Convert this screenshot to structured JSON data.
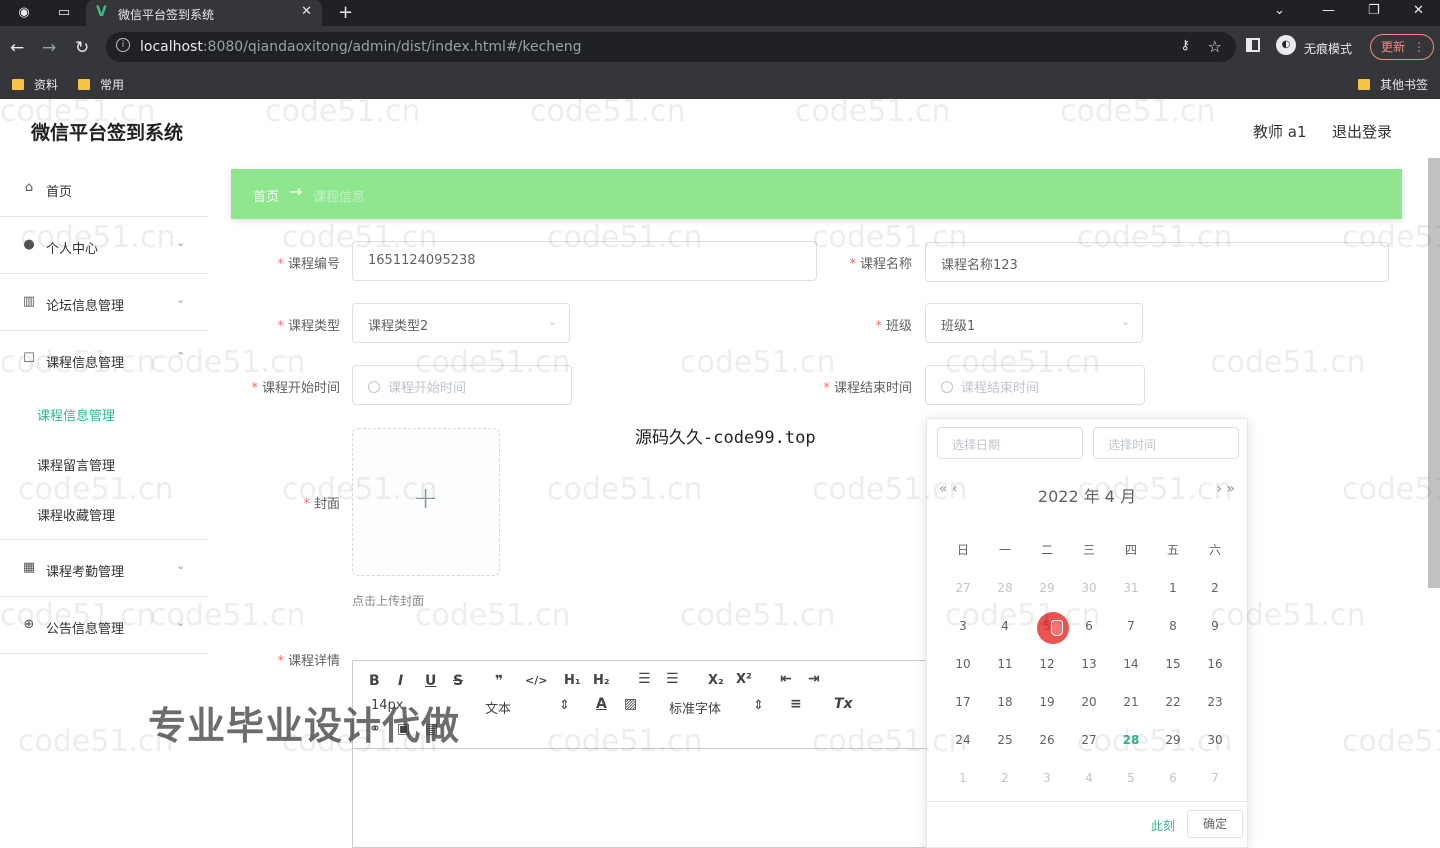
{
  "browser": {
    "tab_title": "微信平台签到系统",
    "url_host": "localhost",
    "url_rest": ":8080/qiandaoxitong/admin/dist/index.html#/kecheng",
    "incognito_label": "无痕模式",
    "update_label": "更新",
    "bookmarks": [
      "资料",
      "常用"
    ],
    "other_bookmarks": "其他书签"
  },
  "header": {
    "site_title": "微信平台签到系统",
    "user": "教师 a1",
    "logout": "退出登录"
  },
  "sidebar": {
    "items": [
      {
        "label": "首页",
        "icon": "home-icon"
      },
      {
        "label": "个人中心",
        "icon": "user-icon"
      },
      {
        "label": "论坛信息管理",
        "icon": "bars-icon"
      },
      {
        "label": "课程信息管理",
        "icon": "square-icon"
      },
      {
        "label": "课程考勤管理",
        "icon": "grid-icon"
      },
      {
        "label": "公告信息管理",
        "icon": "globe-icon"
      }
    ],
    "sub_items": [
      "课程信息管理",
      "课程留言管理",
      "课程收藏管理"
    ]
  },
  "breadcrumb": {
    "home": "首页",
    "arrow": "→",
    "current": "课程信息"
  },
  "form": {
    "course_no_label": "课程编号",
    "course_no_value": "1651124095238",
    "course_name_label": "课程名称",
    "course_name_value": "课程名称123",
    "course_type_label": "课程类型",
    "course_type_value": "课程类型2",
    "class_label": "班级",
    "class_value": "班级1",
    "start_label": "课程开始时间",
    "start_placeholder": "课程开始时间",
    "end_label": "课程结束时间",
    "end_placeholder": "课程结束时间",
    "cover_label": "封面",
    "upload_hint": "点击上传封面",
    "detail_label": "课程详情"
  },
  "editor": {
    "font_size": "14px",
    "paragraph": "文本",
    "font_family": "标准字体"
  },
  "picker": {
    "date_placeholder": "选择日期",
    "time_placeholder": "选择时间",
    "header": "2022 年  4 月",
    "weekdays": [
      "日",
      "一",
      "二",
      "三",
      "四",
      "五",
      "六"
    ],
    "weeks": [
      [
        "27",
        "28",
        "29",
        "30",
        "31",
        "1",
        "2"
      ],
      [
        "3",
        "4",
        "5",
        "6",
        "7",
        "8",
        "9"
      ],
      [
        "10",
        "11",
        "12",
        "13",
        "14",
        "15",
        "16"
      ],
      [
        "17",
        "18",
        "19",
        "20",
        "21",
        "22",
        "23"
      ],
      [
        "24",
        "25",
        "26",
        "27",
        "28",
        "29",
        "30"
      ],
      [
        "1",
        "2",
        "3",
        "4",
        "5",
        "6",
        "7"
      ]
    ],
    "today": "28",
    "now_label": "此刻",
    "ok_label": "确定"
  },
  "watermarks": {
    "center": "源码久久-code99.top",
    "big": "专业毕业设计代做",
    "repeat": "code51.cn"
  },
  "colors": {
    "accent": "#2fb98a",
    "breadcrumb_bg": "#8ee68e",
    "required": "#f56c6c"
  }
}
